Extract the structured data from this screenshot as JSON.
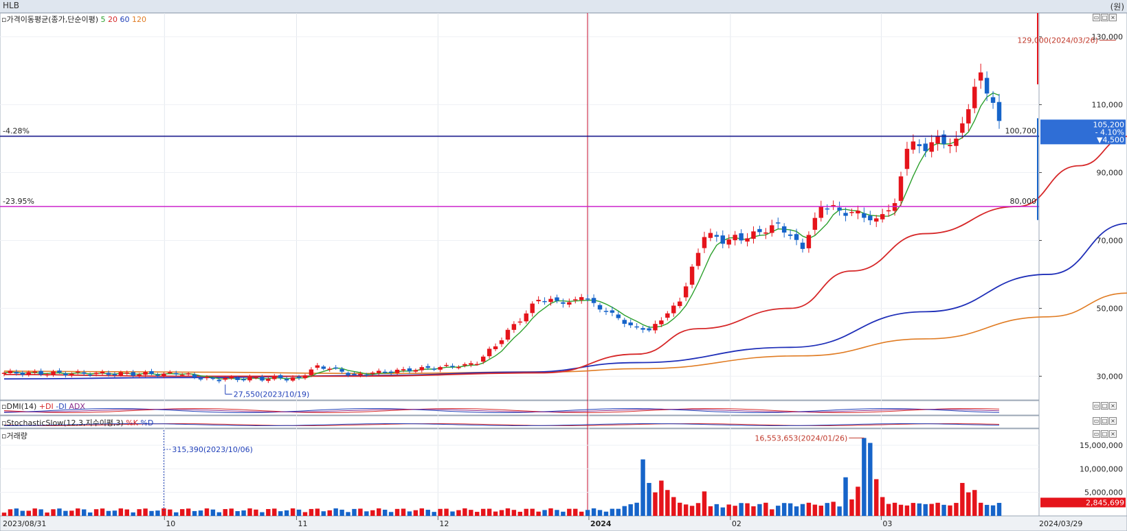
{
  "window": {
    "title": "HLB",
    "unit": "(원)"
  },
  "legends": {
    "price": {
      "name": "가격이동평균(종가,단순이평)",
      "ma5": "5",
      "ma20": "20",
      "ma60": "60",
      "ma120": "120"
    },
    "dmi": {
      "name": "DMI(14)",
      "pdi": "+DI",
      "mdi": "-DI",
      "adx": "ADX"
    },
    "stoch": {
      "name": "StochasticSlow(12,3,지수이평,3)",
      "k": "%K",
      "d": "%D"
    },
    "volume": {
      "name": "거래량"
    }
  },
  "colors": {
    "up": "#e5141b",
    "down": "#1664c9",
    "ma5": "#2ca02c",
    "ma20": "#d62728",
    "ma60": "#1f2fb8",
    "ma120": "#e07b22",
    "hline_navy": "#1a1a8c",
    "hline_magenta": "#cc22cc",
    "date_marker": "#c8102e"
  },
  "chart_data": {
    "type": "candlestick",
    "price_axis": {
      "ylim": [
        23000,
        137000
      ],
      "ticks": [
        30000,
        50000,
        70000,
        90000,
        110000,
        130000
      ],
      "tick_labels": [
        "30,000",
        "50,000",
        "70,000",
        "90,000",
        "110,000",
        "130,000"
      ]
    },
    "date_axis": {
      "labels": [
        "2023/08/31",
        "10",
        "11",
        "12",
        "2024",
        "02",
        "03",
        "2024/03/29"
      ],
      "label_dates": [
        "2023-08-31",
        "2023-10-04",
        "2023-11-01",
        "2023-12-01",
        "2024-01-02",
        "2024-02-01",
        "2024-03-04",
        "2024-03-29"
      ]
    },
    "hlines": [
      {
        "value": 100700,
        "left_label": "-4.28%",
        "right_label": "100,700"
      },
      {
        "value": 80000,
        "left_label": "-23.95%",
        "right_label": "80,000"
      }
    ],
    "current": {
      "price": "105,200",
      "change_pct": "- 4.10%",
      "change": "▼4,500"
    },
    "annotations": {
      "max": "129,000(2024/03/26)",
      "min": "27,550(2023/10/19)",
      "vol_max": "16,553,653(2024/01/26)",
      "vol_min": "315,390(2023/10/06)"
    },
    "vertical_marker_date": "2024-01-02",
    "segments": [
      {
        "n": 29,
        "start": 31000,
        "end": 30600,
        "amp": 600
      },
      {
        "n": 6,
        "start": 30600,
        "end": 29200,
        "amp": 700
      },
      {
        "n": 14,
        "start": 29200,
        "end": 29500,
        "amp": 700
      },
      {
        "n": 3,
        "start": 29500,
        "end": 33200,
        "amp": 500
      },
      {
        "n": 6,
        "start": 33200,
        "end": 30500,
        "amp": 600
      },
      {
        "n": 20,
        "start": 30500,
        "end": 33600,
        "amp": 500
      },
      {
        "n": 10,
        "start": 33600,
        "end": 52500,
        "amp": 800
      },
      {
        "n": 5,
        "start": 52500,
        "end": 51800,
        "amp": 600
      },
      {
        "n": 2,
        "start": 51800,
        "end": 53300,
        "amp": 300
      },
      {
        "n": 8,
        "start": 53300,
        "end": 45000,
        "amp": 600
      },
      {
        "n": 3,
        "start": 45000,
        "end": 43500,
        "amp": 300
      },
      {
        "n": 5,
        "start": 43500,
        "end": 52000,
        "amp": 500
      },
      {
        "n": 4,
        "start": 52000,
        "end": 71000,
        "amp": 800
      },
      {
        "n": 6,
        "start": 71000,
        "end": 70000,
        "amp": 1500
      },
      {
        "n": 6,
        "start": 70000,
        "end": 75000,
        "amp": 1000
      },
      {
        "n": 4,
        "start": 75000,
        "end": 67500,
        "amp": 800
      },
      {
        "n": 3,
        "start": 67500,
        "end": 80000,
        "amp": 800
      },
      {
        "n": 9,
        "start": 80000,
        "end": 76500,
        "amp": 1200
      },
      {
        "n": 3,
        "start": 76500,
        "end": 81000,
        "amp": 700
      },
      {
        "n": 2,
        "start": 81000,
        "end": 97000,
        "amp": 800
      },
      {
        "n": 8,
        "start": 97000,
        "end": 100000,
        "amp": 1800
      },
      {
        "n": 4,
        "start": 100000,
        "end": 119500,
        "amp": 1200
      },
      {
        "n": 3,
        "start": 119500,
        "end": 105200,
        "amp": 1500
      }
    ],
    "ma_approx": {
      "ma20_knots": [
        [
          0,
          30500
        ],
        [
          28,
          30000
        ],
        [
          58,
          30000
        ],
        [
          88,
          31000
        ],
        [
          103,
          36500
        ],
        [
          113,
          44000
        ],
        [
          128,
          50000
        ],
        [
          138,
          61000
        ],
        [
          150,
          72000
        ],
        [
          165,
          80000
        ],
        [
          175,
          92000
        ],
        [
          183,
          100700
        ]
      ],
      "ma60_knots": [
        [
          0,
          29200
        ],
        [
          30,
          29600
        ],
        [
          60,
          30200
        ],
        [
          85,
          31200
        ],
        [
          103,
          34000
        ],
        [
          128,
          38500
        ],
        [
          150,
          49000
        ],
        [
          170,
          60000
        ],
        [
          183,
          75000
        ]
      ],
      "ma120_knots": [
        [
          0,
          31500
        ],
        [
          30,
          31200
        ],
        [
          60,
          30800
        ],
        [
          90,
          31300
        ],
        [
          103,
          32200
        ],
        [
          130,
          36000
        ],
        [
          150,
          41000
        ],
        [
          170,
          47500
        ],
        [
          183,
          54500
        ]
      ]
    },
    "volume": {
      "ylim": [
        0,
        18500000
      ],
      "ticks": [
        5000000,
        10000000,
        15000000
      ],
      "tick_labels": [
        "5,000,000",
        "10,000,000",
        "15,000,000"
      ],
      "current_label": "2,845,699",
      "spikes": [
        {
          "at": 104,
          "v": 12000000
        },
        {
          "at": 105,
          "v": 7000000
        },
        {
          "at": 106,
          "v": 5000000
        },
        {
          "at": 107,
          "v": 7500000
        },
        {
          "at": 108,
          "v": 5500000
        },
        {
          "at": 109,
          "v": 4000000
        },
        {
          "at": 114,
          "v": 5200000
        },
        {
          "at": 117,
          "v": 1800000
        },
        {
          "at": 125,
          "v": 1400000
        },
        {
          "at": 135,
          "v": 3000000
        },
        {
          "at": 137,
          "v": 8200000
        },
        {
          "at": 138,
          "v": 3500000
        },
        {
          "at": 139,
          "v": 6200000
        },
        {
          "at": 140,
          "v": 16553653
        },
        {
          "at": 141,
          "v": 15500000
        },
        {
          "at": 142,
          "v": 7800000
        },
        {
          "at": 143,
          "v": 4000000
        },
        {
          "at": 150,
          "v": 2500000
        },
        {
          "at": 156,
          "v": 7000000
        },
        {
          "at": 157,
          "v": 5000000
        },
        {
          "at": 158,
          "v": 5500000
        },
        {
          "at": 170,
          "v": 13000000
        },
        {
          "at": 171,
          "v": 7500000
        },
        {
          "at": 172,
          "v": 4000000
        },
        {
          "at": 173,
          "v": 3200000
        },
        {
          "at": 174,
          "v": 9000000
        },
        {
          "at": 175,
          "v": 5000000
        },
        {
          "at": 176,
          "v": 3500000
        },
        {
          "at": 180,
          "v": 7500000
        },
        {
          "at": 181,
          "v": 4200000
        },
        {
          "at": 182,
          "v": 3600000
        },
        {
          "at": 183,
          "v": 2845699
        }
      ]
    }
  }
}
